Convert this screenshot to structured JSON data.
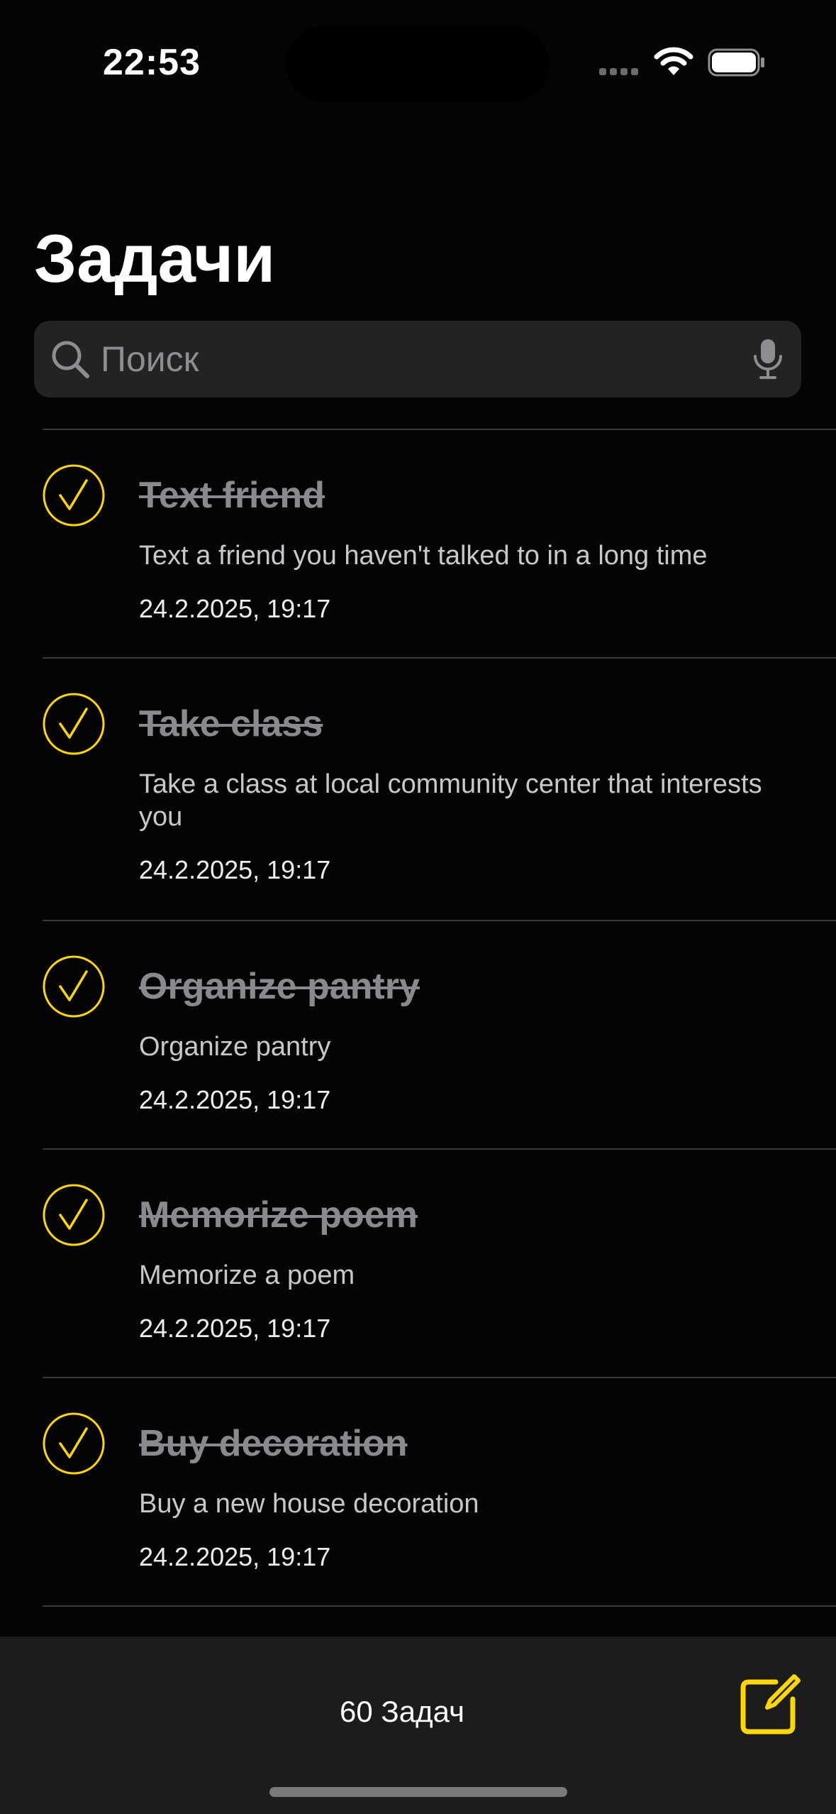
{
  "status_bar": {
    "time": "22:53"
  },
  "header": {
    "title": "Задачи"
  },
  "search": {
    "placeholder": "Поиск",
    "value": ""
  },
  "tasks": [
    {
      "title": "Text friend",
      "description": "Text a friend you haven't talked to in a long time",
      "date": "24.2.2025, 19:17",
      "completed": true
    },
    {
      "title": "Take class",
      "description": "Take a class at local community center that interests you",
      "date": "24.2.2025, 19:17",
      "completed": true
    },
    {
      "title": "Organize pantry",
      "description": "Organize pantry",
      "date": "24.2.2025, 19:17",
      "completed": true
    },
    {
      "title": "Memorize poem",
      "description": "Memorize a poem",
      "date": "24.2.2025, 19:17",
      "completed": true
    },
    {
      "title": "Buy decoration",
      "description": "Buy a new house decoration",
      "date": "24.2.2025, 19:17",
      "completed": true
    }
  ],
  "footer": {
    "count_label": "60 Задач"
  },
  "icons": {
    "check": "checkmark-circle-icon",
    "compose": "compose-icon",
    "search": "search-icon",
    "mic": "mic-icon"
  },
  "colors": {
    "accent": "#FED702",
    "background": "#040404",
    "bottom_bar": "#1C1C1C",
    "search_bg": "#232323"
  }
}
